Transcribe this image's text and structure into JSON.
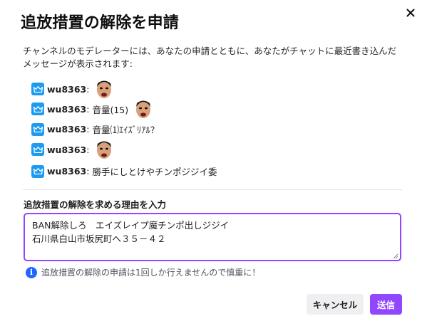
{
  "modal": {
    "title": "追放措置の解除を申請",
    "description": "チャンネルのモデレーターには、あなたの申請とともに、あなたがチャットに最近書き込んだメッセージが表示されます:",
    "close_icon": "close-icon"
  },
  "messages": [
    {
      "username": "wu8363",
      "separator": ":",
      "text": "",
      "emote": true,
      "badge": "moderator-crown-icon"
    },
    {
      "username": "wu8363",
      "separator": ":",
      "text": "音量(15)",
      "emote": true,
      "badge": "moderator-crown-icon"
    },
    {
      "username": "wu8363",
      "separator": ":",
      "text": "音量⑴ｴｲｽﾞﾘｱﾙ？",
      "emote": false,
      "badge": "moderator-crown-icon"
    },
    {
      "username": "wu8363",
      "separator": ":",
      "text": "",
      "emote": true,
      "badge": "moderator-crown-icon"
    },
    {
      "username": "wu8363",
      "separator": ":",
      "text": "勝手にしとけやチンポジジイ委",
      "emote": false,
      "badge": "moderator-crown-icon"
    }
  ],
  "form": {
    "label": "追放措置の解除を求める理由を入力",
    "value": "BAN解除しろ　エイズレイプ魔チンポ出しジジイ\n石川県白山市坂尻町へ３５－４２"
  },
  "info": {
    "icon": "info-icon",
    "text": "追放措置の解除の申請は1回しか行えませんので慎重に！"
  },
  "buttons": {
    "cancel": "キャンセル",
    "send": "送信"
  },
  "colors": {
    "accent": "#9147ff",
    "badge": "#1d9bf0",
    "info": "#1f69ff"
  }
}
